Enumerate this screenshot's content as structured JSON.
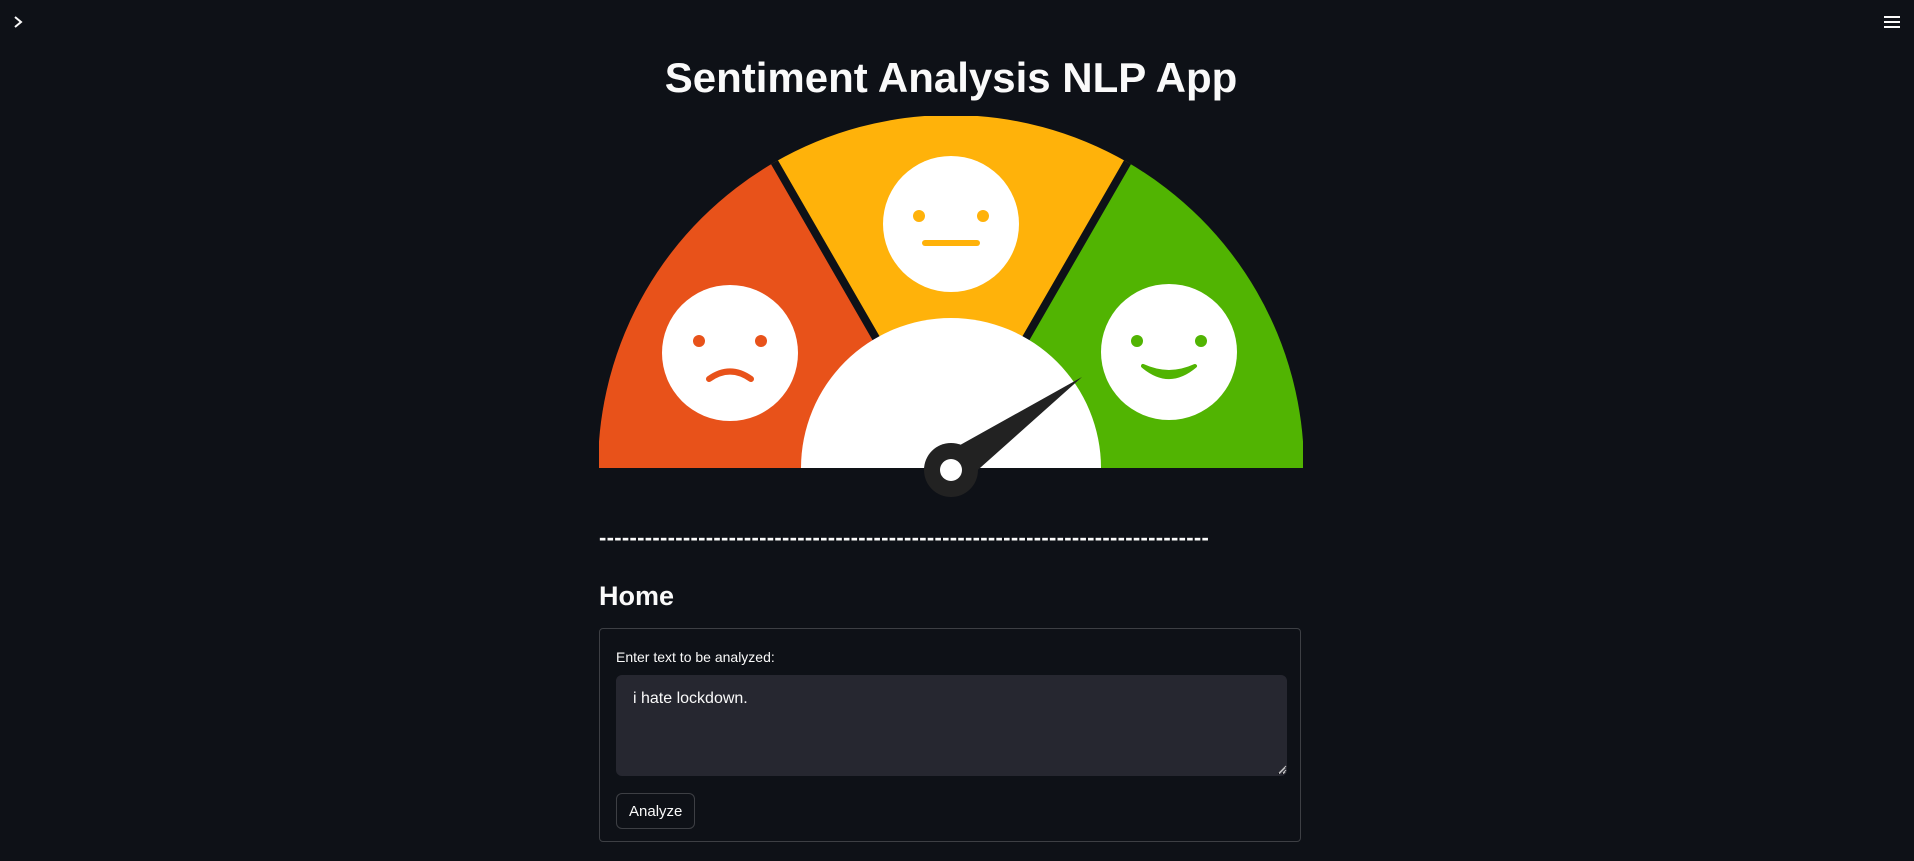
{
  "header": {
    "sidebar_toggle_icon": "chevron-right-icon",
    "menu_icon": "hamburger-menu-icon"
  },
  "main": {
    "title": "Sentiment Analysis NLP App",
    "divider": "--------------------------------------------------------------------------------",
    "section_heading": "Home",
    "gauge": {
      "image": "sentiment-gauge-illustration",
      "segments": [
        {
          "mood": "sad",
          "color": "#e8521a"
        },
        {
          "mood": "neutral",
          "color": "#ffb20a"
        },
        {
          "mood": "happy",
          "color": "#51b402"
        }
      ],
      "needle_color": "#222222"
    },
    "form": {
      "label": "Enter text to be analyzed:",
      "text_value": "i hate lockdown.",
      "submit_label": "Analyze"
    }
  },
  "colors": {
    "background": "#0e1117",
    "text": "#fafafa",
    "input_background": "#262730"
  }
}
